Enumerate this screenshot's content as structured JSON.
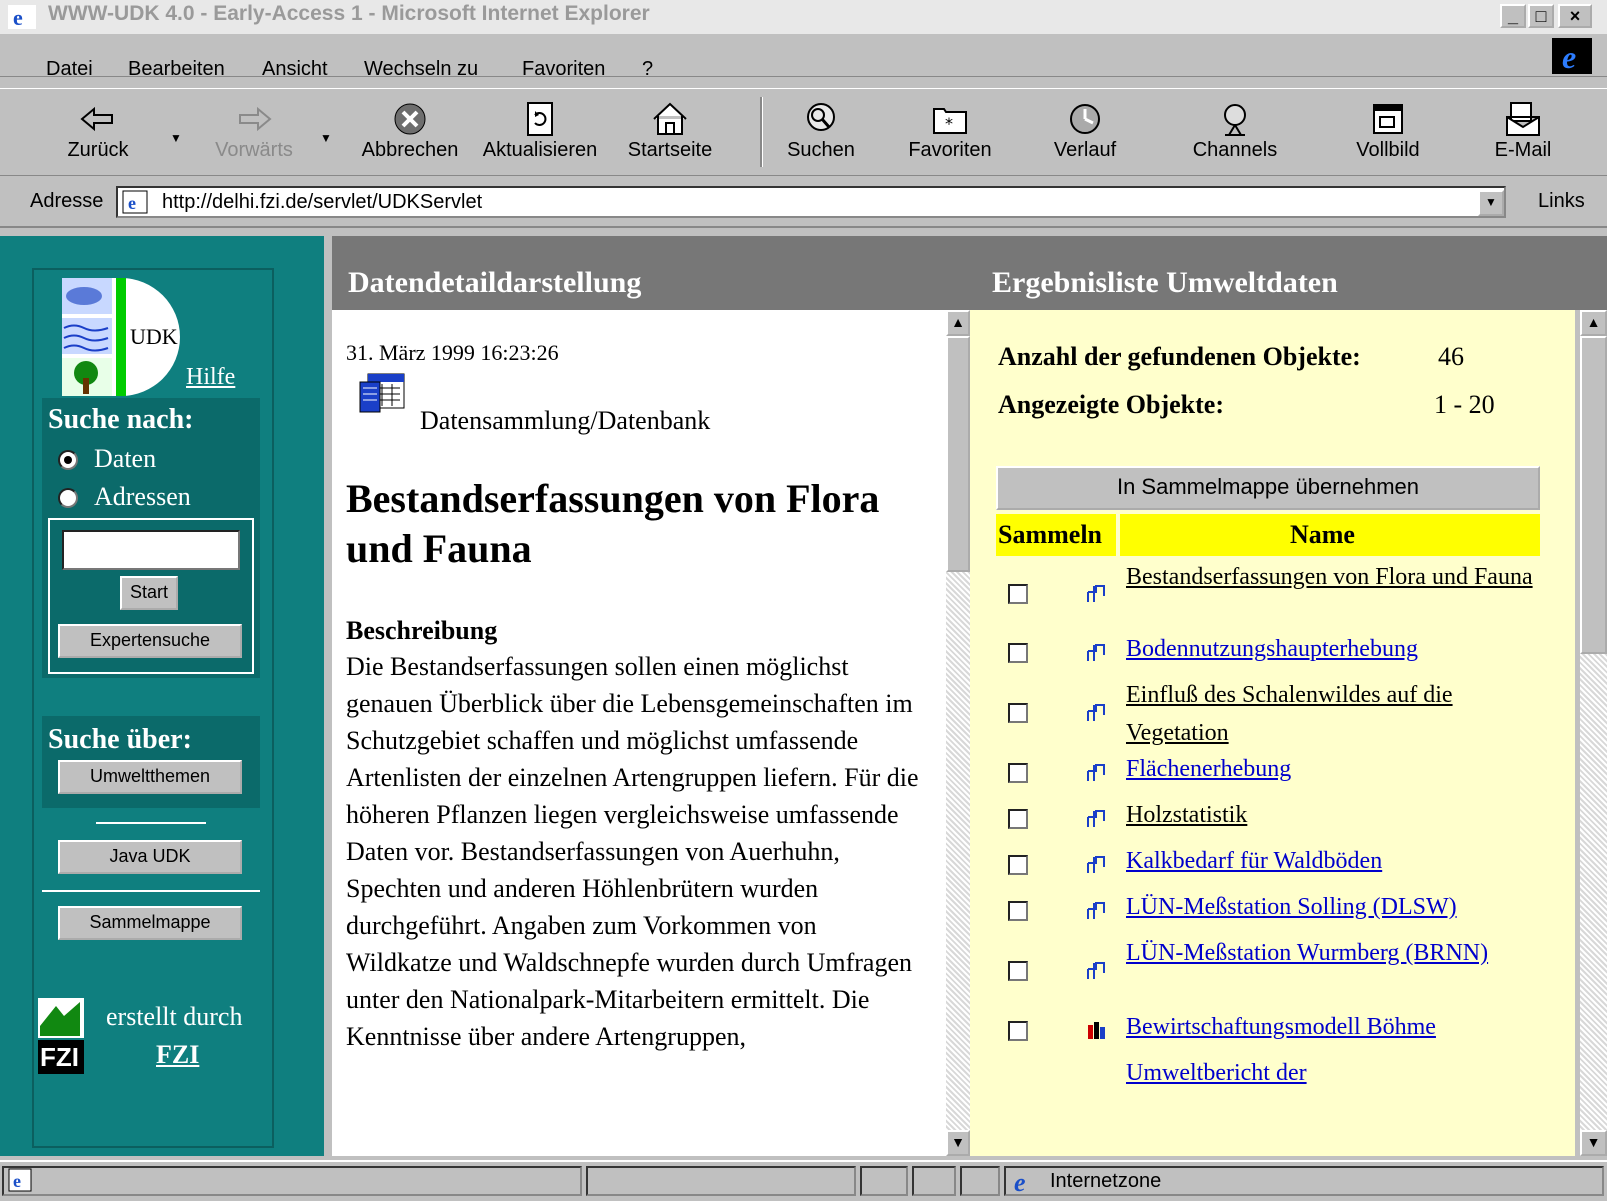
{
  "window": {
    "title": "WWW-UDK 4.0 - Early-Access 1 - Microsoft Internet Explorer",
    "controls": [
      "_",
      "□",
      "×"
    ]
  },
  "menu": [
    "Datei",
    "Bearbeiten",
    "Ansicht",
    "Wechseln zu",
    "Favoriten",
    "?"
  ],
  "toolbar": {
    "back": "Zurück",
    "forward": "Vorwärts",
    "stop": "Abbrechen",
    "refresh": "Aktualisieren",
    "home": "Startseite",
    "search": "Suchen",
    "favorites": "Favoriten",
    "history": "Verlauf",
    "channels": "Channels",
    "fullscreen": "Vollbild",
    "mail": "E-Mail"
  },
  "address": {
    "label": "Adresse",
    "url": "http://delhi.fzi.de/servlet/UDKServlet",
    "links": "Links"
  },
  "left": {
    "logo_text": "UDK",
    "help": "Hilfe",
    "search_for": "Suche nach:",
    "radio_data": "Daten",
    "radio_addresses": "Adressen",
    "start": "Start",
    "expert": "Expertensuche",
    "search_via": "Suche über:",
    "topics": "Umweltthemen",
    "java": "Java UDK",
    "collection": "Sammelmappe",
    "created_by": "erstellt durch",
    "fzi": "FZI",
    "fzi_logo": "FZI"
  },
  "middle": {
    "header": "Datendetaildarstellung",
    "date": "31. März 1999 16:23:26",
    "type": "Datensammlung/Datenbank",
    "title": "Bestandserfassungen von Flora und Fauna",
    "section": "Beschreibung",
    "body": "Die Bestandserfassungen sollen einen möglichst genauen Überblick über die Lebensgemeinschaften im Schutzgebiet schaffen und möglichst umfassende Artenlisten der einzelnen Artengruppen liefern. Für die höheren Pflanzen liegen vergleichsweise umfassende Daten vor. Bestandserfassungen von Auerhuhn, Spechten und anderen Höhlenbrütern wurden durchgeführt. Angaben zum Vorkommen von Wildkatze und Waldschnepfe wurden durch Umfragen unter den Nationalpark-Mitarbeitern ermittelt. Die Kenntnisse über andere Artengruppen,"
  },
  "right": {
    "header": "Ergebnisliste Umweltdaten",
    "found_label": "Anzahl der gefundenen Objekte:",
    "found_value": "46",
    "shown_label": "Angezeigte Objekte:",
    "shown_value": "1 - 20",
    "collect_button": "In Sammelmappe übernehmen",
    "col_collect": "Sammeln",
    "col_name": "Name",
    "results": [
      {
        "name": "Bestandserfassungen von Flora und Fauna",
        "visited": true
      },
      {
        "name": "Bodennutzungshaupterhebung",
        "visited": false
      },
      {
        "name": "Einfluß des Schalenwildes auf die Vegetation",
        "visited": true
      },
      {
        "name": "Flächenerhebung",
        "visited": false
      },
      {
        "name": "Holzstatistik",
        "visited": true
      },
      {
        "name": "Kalkbedarf für Waldböden",
        "visited": false
      },
      {
        "name": "LÜN-Meßstation Solling (DLSW)",
        "visited": false
      },
      {
        "name": "LÜN-Meßstation Wurmberg (BRNN)",
        "visited": false
      },
      {
        "name": "Bewirtschaftungsmodell Böhme",
        "visited": false
      },
      {
        "name": "Umweltbericht der",
        "visited": false
      }
    ]
  },
  "status": {
    "zone": "Internetzone"
  },
  "colors": {
    "left_bg": "#0f7f7f",
    "right_bg": "#ffffcc",
    "table_header": "#ffff00",
    "link": "#0000cc"
  }
}
